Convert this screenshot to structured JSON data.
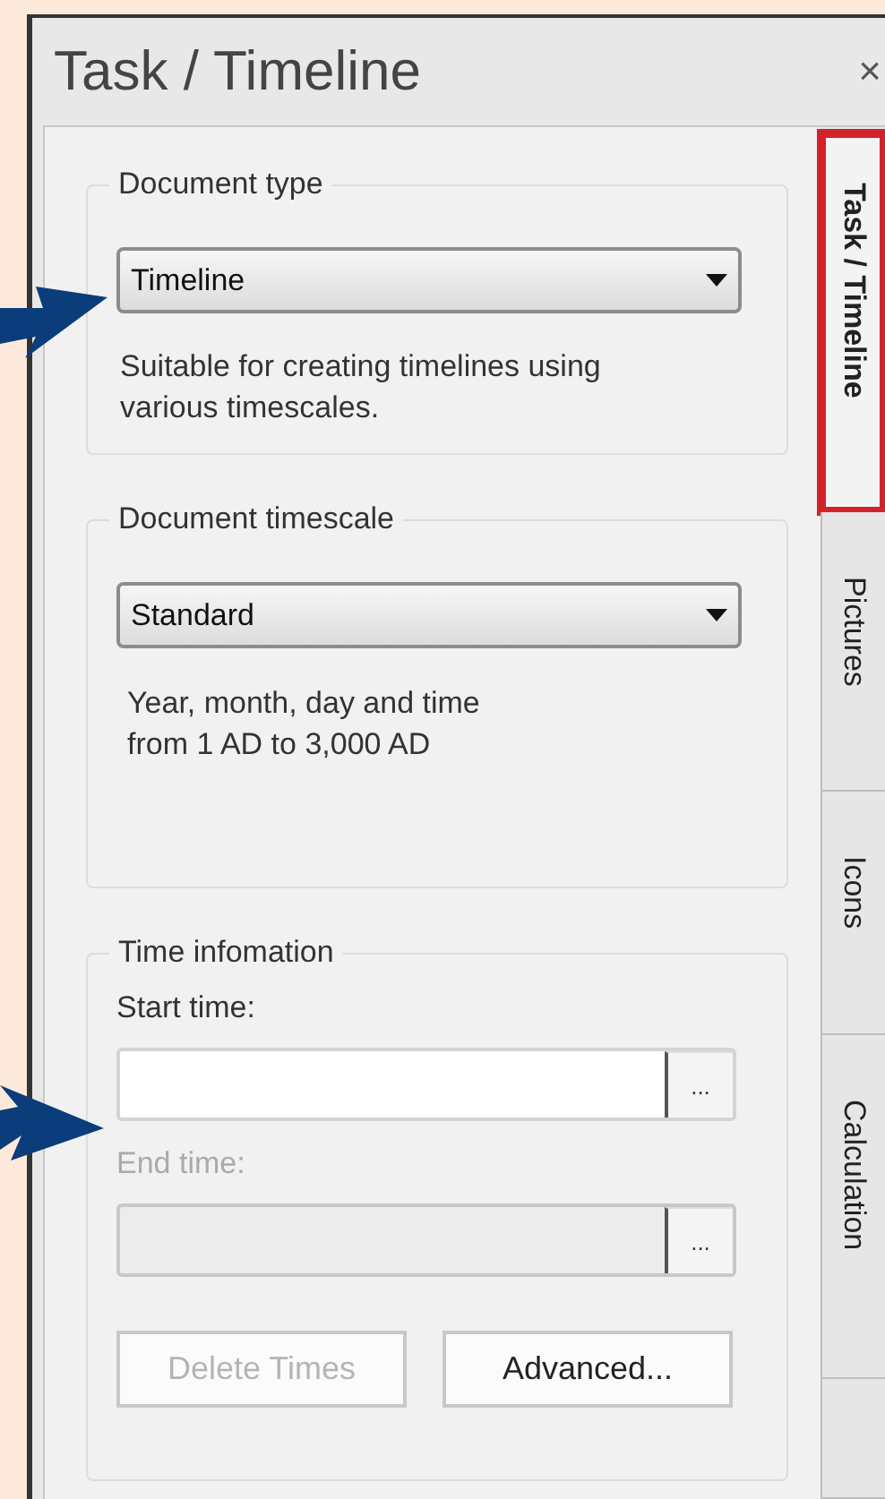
{
  "panel": {
    "title": "Task / Timeline",
    "close": "×"
  },
  "document_type": {
    "legend": "Document type",
    "value": "Timeline",
    "description": [
      "Suitable for creating timelines using",
      "various timescales."
    ]
  },
  "document_timescale": {
    "legend": "Document timescale",
    "value": "Standard",
    "description": [
      "Year, month, day and time",
      "from 1 AD to 3,000 AD"
    ]
  },
  "time_information": {
    "legend": "Time infomation",
    "fields": [
      {
        "label": "Start time:",
        "browse": "...",
        "disabled": false
      },
      {
        "label": "End time:",
        "browse": "...",
        "disabled": true
      }
    ],
    "buttons": [
      {
        "label": "Delete Times",
        "disabled": true
      },
      {
        "label": "Advanced...",
        "disabled": false
      }
    ]
  },
  "tabs": [
    {
      "label": "Task / Timeline",
      "selected": true
    },
    {
      "label": "Pictures",
      "selected": false
    },
    {
      "label": "Icons",
      "selected": false
    },
    {
      "label": "Calculation",
      "selected": false
    }
  ]
}
